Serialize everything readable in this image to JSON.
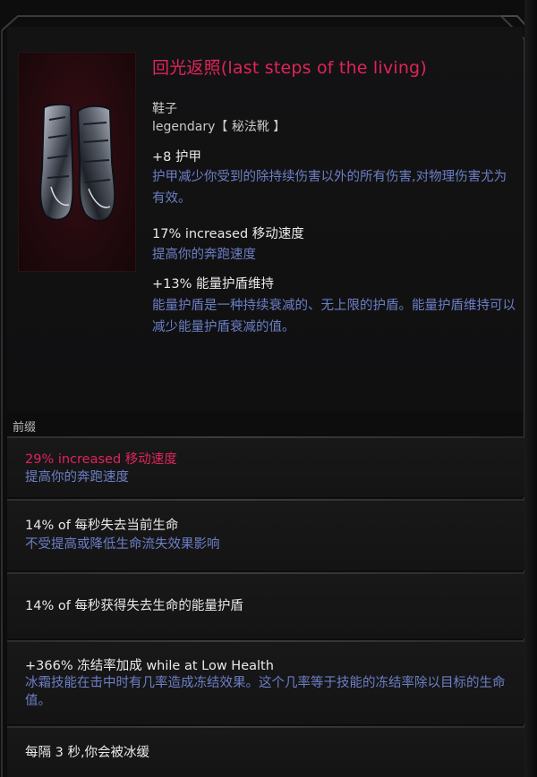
{
  "item": {
    "name": "回光返照(last steps of the living)",
    "type": "鞋子",
    "rarity": "legendary【 秘法靴 】",
    "stats": [
      {
        "value": "+8 护甲",
        "description": "护甲减少你受到的除持续伤害以外的所有伤害,对物理伤害尤为有效。"
      },
      {
        "value": "17% increased 移动速度",
        "description": "提高你的奔跑速度"
      },
      {
        "value": "+13% 能量护盾维持",
        "description": "能量护盾是一种持续衰减的、无上限的护盾。能量护盾维持可以减少能量护盾衰减的值。"
      }
    ]
  },
  "affix_section": {
    "label": "前缀",
    "affixes": [
      {
        "value": "29% increased 移动速度",
        "description": "提高你的奔跑速度",
        "highlight": true
      },
      {
        "value": "14% of 每秒失去当前生命",
        "description": "不受提高或降低生命流失效果影响",
        "highlight": false
      },
      {
        "value": "14% of 每秒获得失去生命的能量护盾",
        "description": "",
        "highlight": false
      },
      {
        "value": "+366% 冻结率加成 while at Low Health",
        "description": "冰霜技能在击中时有几率造成冻结效果。这个几率等于技能的冻结率除以目标的生命值。",
        "highlight": false
      },
      {
        "value": "每隔 3 秒,你会被冰缓",
        "description": "",
        "highlight": false
      }
    ]
  },
  "colors": {
    "legendary_red": "#e0245a",
    "description_blue": "#6c7fc5",
    "stat_white": "#e9e9e9",
    "background": "#0d0d0e"
  },
  "icons": {
    "item_icon": "armored-boots-icon"
  }
}
